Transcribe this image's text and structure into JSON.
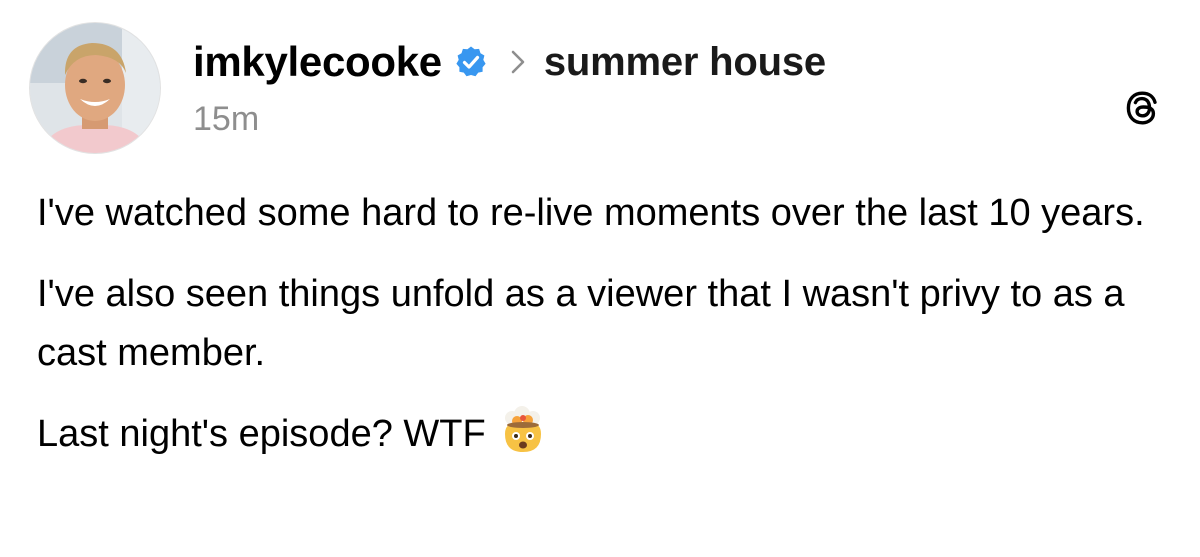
{
  "post": {
    "username": "imkylecooke",
    "verified": true,
    "community": "summer house",
    "timestamp": "15m",
    "paragraphs": [
      "I've watched some hard to re-live moments over the last 10 years.",
      "I've also seen things unfold as a viewer that I wasn't privy to as a cast member.",
      "Last night's episode? WTF"
    ],
    "emoji": "exploding-head"
  },
  "icons": {
    "verified": "verified-badge-icon",
    "chevron": "chevron-right-icon",
    "app": "threads-logo-icon"
  },
  "colors": {
    "verified_badge": "#3897f0",
    "timestamp": "#8e8e8e",
    "text": "#000000",
    "background": "#ffffff"
  }
}
